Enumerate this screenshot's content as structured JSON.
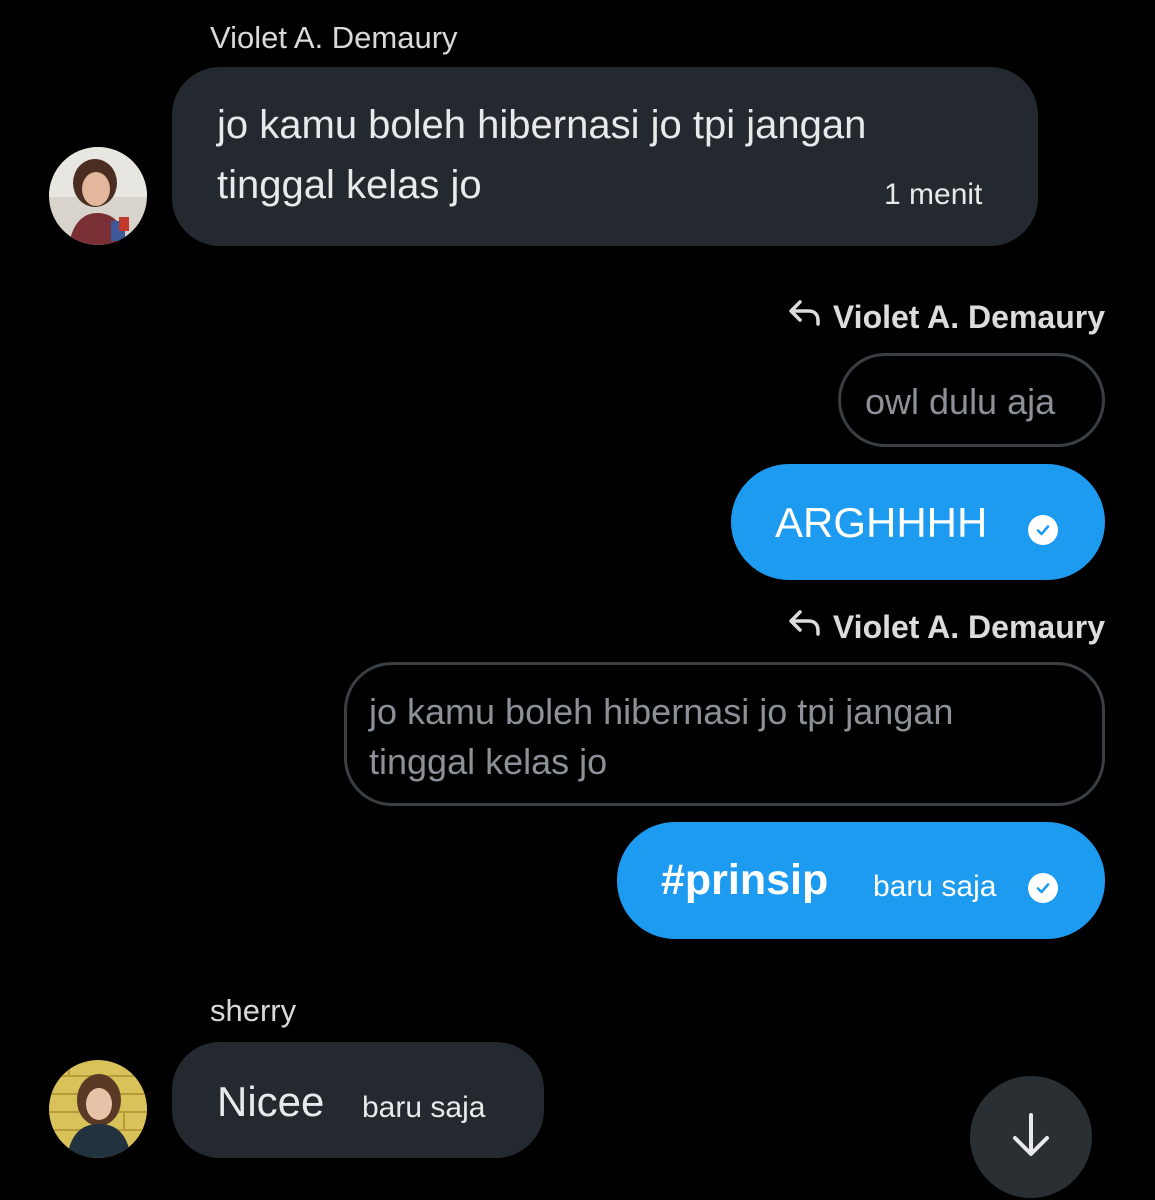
{
  "messages": {
    "m1": {
      "sender": "Violet A. Demaury",
      "line1": "jo kamu boleh hibernasi jo tpi jangan",
      "line2": "tinggal kelas jo",
      "time": "1 menit"
    },
    "reply1": {
      "reply_to": "Violet A. Demaury",
      "quoted": "owl dulu aja",
      "text": "ARGHHHH"
    },
    "reply2": {
      "reply_to": "Violet A. Demaury",
      "quoted_line1": "jo kamu boleh hibernasi jo tpi jangan",
      "quoted_line2": "tinggal kelas jo",
      "text": "#prinsip",
      "time": "baru saja"
    },
    "m2": {
      "sender": "sherry",
      "text": "Nicee",
      "time": "baru saja"
    }
  },
  "colors": {
    "background": "#000000",
    "incoming_bubble": "#23292f",
    "outgoing_bubble": "#1d9bf0"
  },
  "icons": {
    "reply": "reply-arrow-icon",
    "sent_check": "check-circle-icon",
    "scroll_down": "arrow-down-icon"
  }
}
